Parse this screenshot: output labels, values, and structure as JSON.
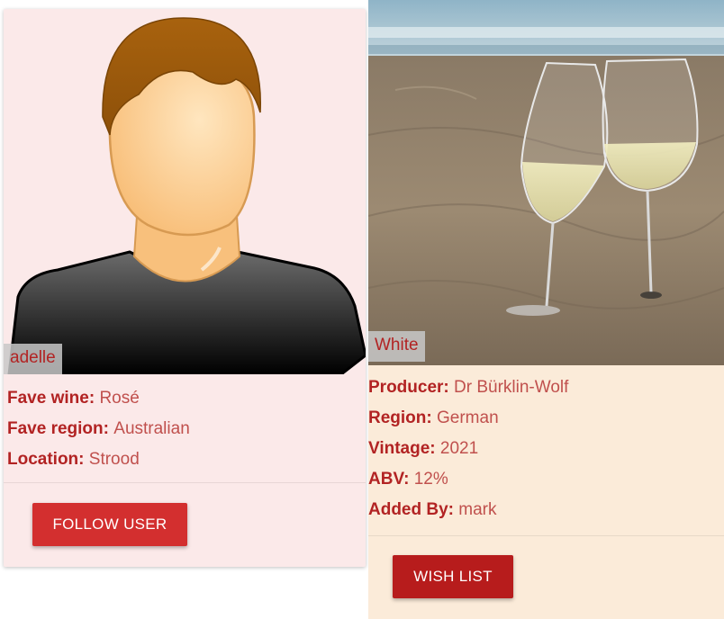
{
  "user_card": {
    "username": "adelle",
    "fields": [
      {
        "label": "Fave wine:",
        "value": "Rosé"
      },
      {
        "label": "Fave region:",
        "value": "Australian"
      },
      {
        "label": "Location:",
        "value": "Strood"
      }
    ],
    "follow_label": "FOLLOW USER",
    "avatar_icon": "user-avatar-icon"
  },
  "wine_card": {
    "title": "White",
    "fields": [
      {
        "label": "Producer:",
        "value": "Dr Bürklin-Wolf"
      },
      {
        "label": "Region:",
        "value": "German"
      },
      {
        "label": "Vintage:",
        "value": "2021"
      },
      {
        "label": "ABV:",
        "value": "12%"
      },
      {
        "label": "Added By:",
        "value": "mark"
      }
    ],
    "wishlist_label": "WISH LIST"
  },
  "colors": {
    "accent": "#b22323",
    "follow_button": "#d32f2f",
    "wishlist_button": "#b71c1c",
    "user_card_bg": "#fbe9e9",
    "wine_card_bg": "#fbebd9"
  }
}
